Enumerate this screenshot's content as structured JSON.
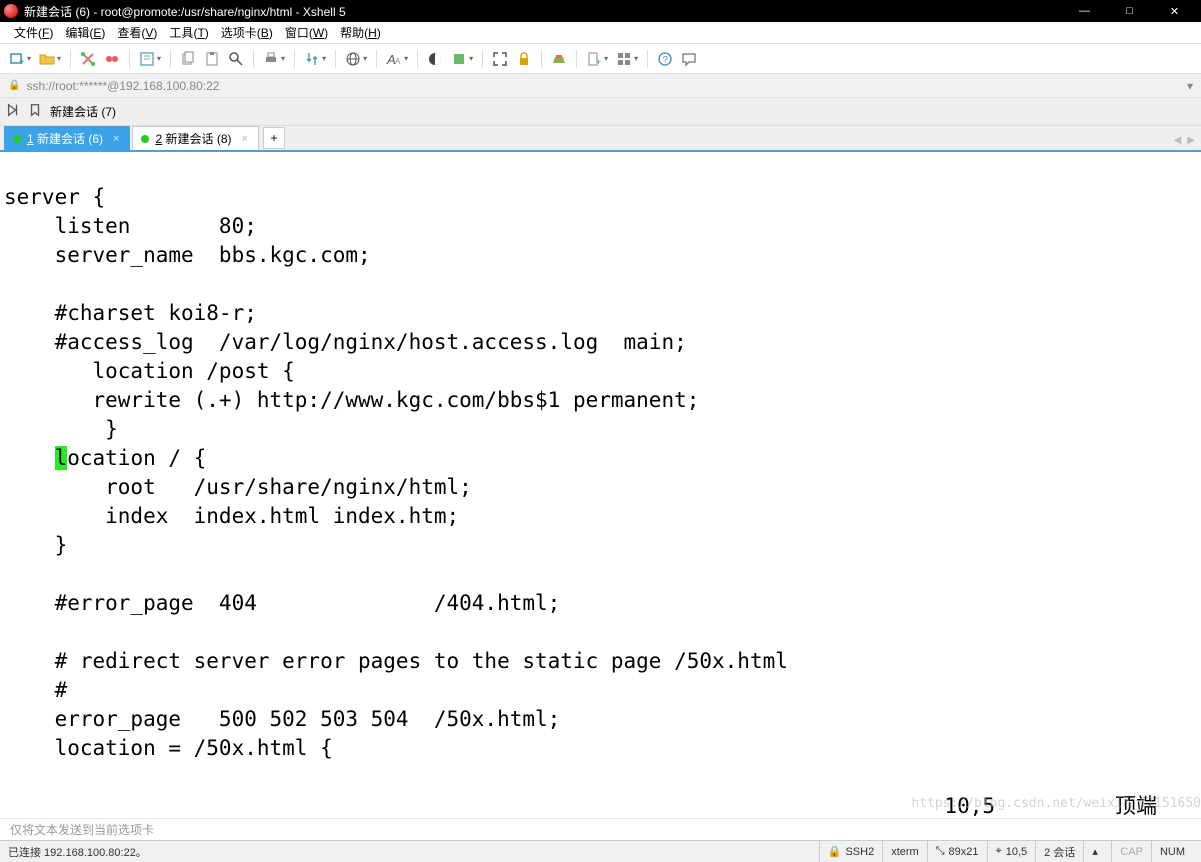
{
  "window": {
    "title": "新建会话 (6) - root@promote:/usr/share/nginx/html - Xshell 5",
    "min": "—",
    "max": "□",
    "close": "✕"
  },
  "menu": [
    {
      "label": "文件",
      "sh": "F"
    },
    {
      "label": "编辑",
      "sh": "E"
    },
    {
      "label": "查看",
      "sh": "V"
    },
    {
      "label": "工具",
      "sh": "T"
    },
    {
      "label": "选项卡",
      "sh": "B"
    },
    {
      "label": "窗口",
      "sh": "W"
    },
    {
      "label": "帮助",
      "sh": "H"
    }
  ],
  "address": "ssh://root:******@192.168.100.80:22",
  "sessionbar": {
    "label": "新建会话 (7)"
  },
  "tabs": {
    "items": [
      {
        "num": "1",
        "label": "新建会话 (6)",
        "active": true
      },
      {
        "num": "2",
        "label": "新建会话 (8)",
        "active": false
      }
    ],
    "add": "+",
    "nav_left": "◀",
    "nav_right": "▶"
  },
  "terminal": {
    "lines": [
      "server {",
      "    listen       80;",
      "    server_name  bbs.kgc.com;",
      "",
      "    #charset koi8-r;",
      "    #access_log  /var/log/nginx/host.access.log  main;",
      "       location /post {",
      "       rewrite (.+) http://www.kgc.com/bbs$1 permanent;",
      "        }",
      {
        "pre": "    ",
        "cursor": "l",
        "post": "ocation / {"
      },
      "        root   /usr/share/nginx/html;",
      "        index  index.html index.htm;",
      "    }",
      "",
      "    #error_page  404              /404.html;",
      "",
      "    # redirect server error pages to the static page /50x.html",
      "    #",
      "    error_page   500 502 503 504  /50x.html;",
      "    location = /50x.html {"
    ],
    "pos": "10,5",
    "mode": "顶端"
  },
  "hint": "仅将文本发送到当前选项卡",
  "status": {
    "left": "已连接 192.168.100.80:22。",
    "ssh": "SSH2",
    "term": "xterm",
    "size": "89x21",
    "pos": "10,5",
    "sess": "2 会话",
    "cap": "CAP",
    "num": "NUM"
  },
  "watermark": "https://blog.csdn.net/weixin_47151650"
}
